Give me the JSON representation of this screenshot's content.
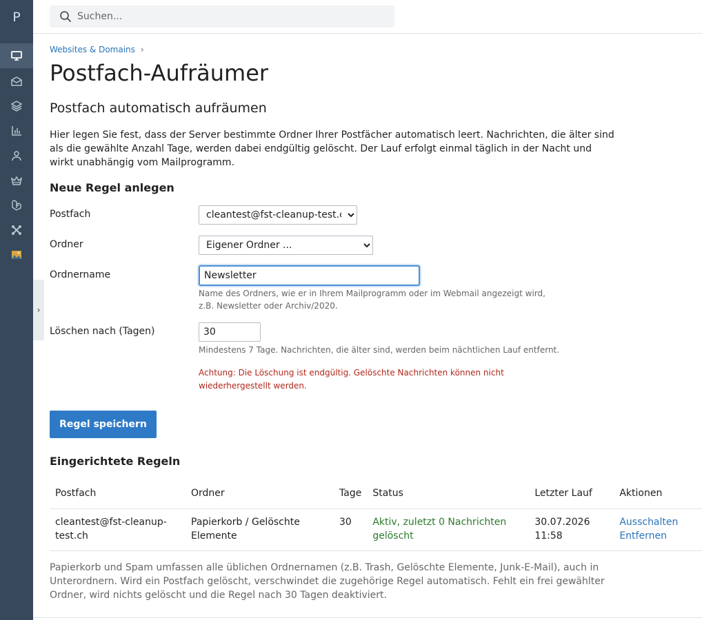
{
  "sidebar": {
    "logo": "P",
    "items": [
      {
        "icon": "monitor-icon",
        "active": true
      },
      {
        "icon": "mail-icon",
        "active": false
      },
      {
        "icon": "layers-icon",
        "active": false
      },
      {
        "icon": "chart-icon",
        "active": false
      },
      {
        "icon": "user-icon",
        "active": false
      },
      {
        "icon": "crown-icon",
        "active": false
      },
      {
        "icon": "laravel-icon",
        "active": false
      },
      {
        "icon": "joomla-icon",
        "active": false
      },
      {
        "icon": "image-app-icon",
        "active": false
      }
    ],
    "collapse_glyph": "›"
  },
  "header": {
    "search_placeholder": "Suchen..."
  },
  "breadcrumb": {
    "items": [
      "Websites & Domains"
    ],
    "separator": "›"
  },
  "page": {
    "title": "Postfach-Aufräumer",
    "section_title": "Postfach automatisch aufräumen",
    "intro": "Hier legen Sie fest, dass der Server bestimmte Ordner Ihrer Postfächer automatisch leert. Nachrichten, die älter sind als die gewählte Anzahl Tage, werden dabei endgültig gelöscht. Der Lauf erfolgt einmal täglich in der Nacht und wirkt unabhängig vom Mailprogramm."
  },
  "form": {
    "heading": "Neue Regel anlegen",
    "mailbox_label": "Postfach",
    "mailbox_value": "cleantest@fst-cleanup-test.ch",
    "folder_label": "Ordner",
    "folder_value": "Eigener Ordner ...",
    "foldername_label": "Ordnername",
    "foldername_value": "Newsletter",
    "foldername_help": "Name des Ordners, wie er in Ihrem Mailprogramm oder im Webmail angezeigt wird, z.B. Newsletter oder Archiv/2020.",
    "days_label": "Löschen nach (Tagen)",
    "days_value": "30",
    "days_help": "Mindestens 7 Tage. Nachrichten, die älter sind, werden beim nächtlichen Lauf entfernt.",
    "warning": "Achtung: Die Löschung ist endgültig. Gelöschte Nachrichten können nicht wiederhergestellt werden.",
    "save_label": "Regel speichern"
  },
  "rules": {
    "heading": "Eingerichtete Regeln",
    "columns": [
      "Postfach",
      "Ordner",
      "Tage",
      "Status",
      "Letzter Lauf",
      "Aktionen"
    ],
    "rows": [
      {
        "mailbox": "cleantest@fst-cleanup-test.ch",
        "folder": "Papierkorb / Gelöschte Elemente",
        "days": "30",
        "status": "Aktiv, zuletzt 0 Nachrichten gelöscht",
        "last_run_date": "30.07.2026",
        "last_run_time": "11:58",
        "action_disable": "Ausschalten",
        "action_remove": "Entfernen"
      }
    ],
    "footnote": "Papierkorb und Spam umfassen alle üblichen Ordnernamen (z.B. Trash, Gelöschte Elemente, Junk-E-Mail), auch in Unterordnern. Wird ein Postfach gelöscht, verschwindet die zugehörige Regel automatisch. Fehlt ein frei gewählter Ordner, wird nichts gelöscht und die Regel nach 30 Tagen deaktiviert."
  },
  "colors": {
    "sidebar_bg": "#36485a",
    "accent": "#2f7ac6",
    "link": "#2873b9",
    "warning": "#b1281c",
    "success": "#2b7a2b"
  }
}
